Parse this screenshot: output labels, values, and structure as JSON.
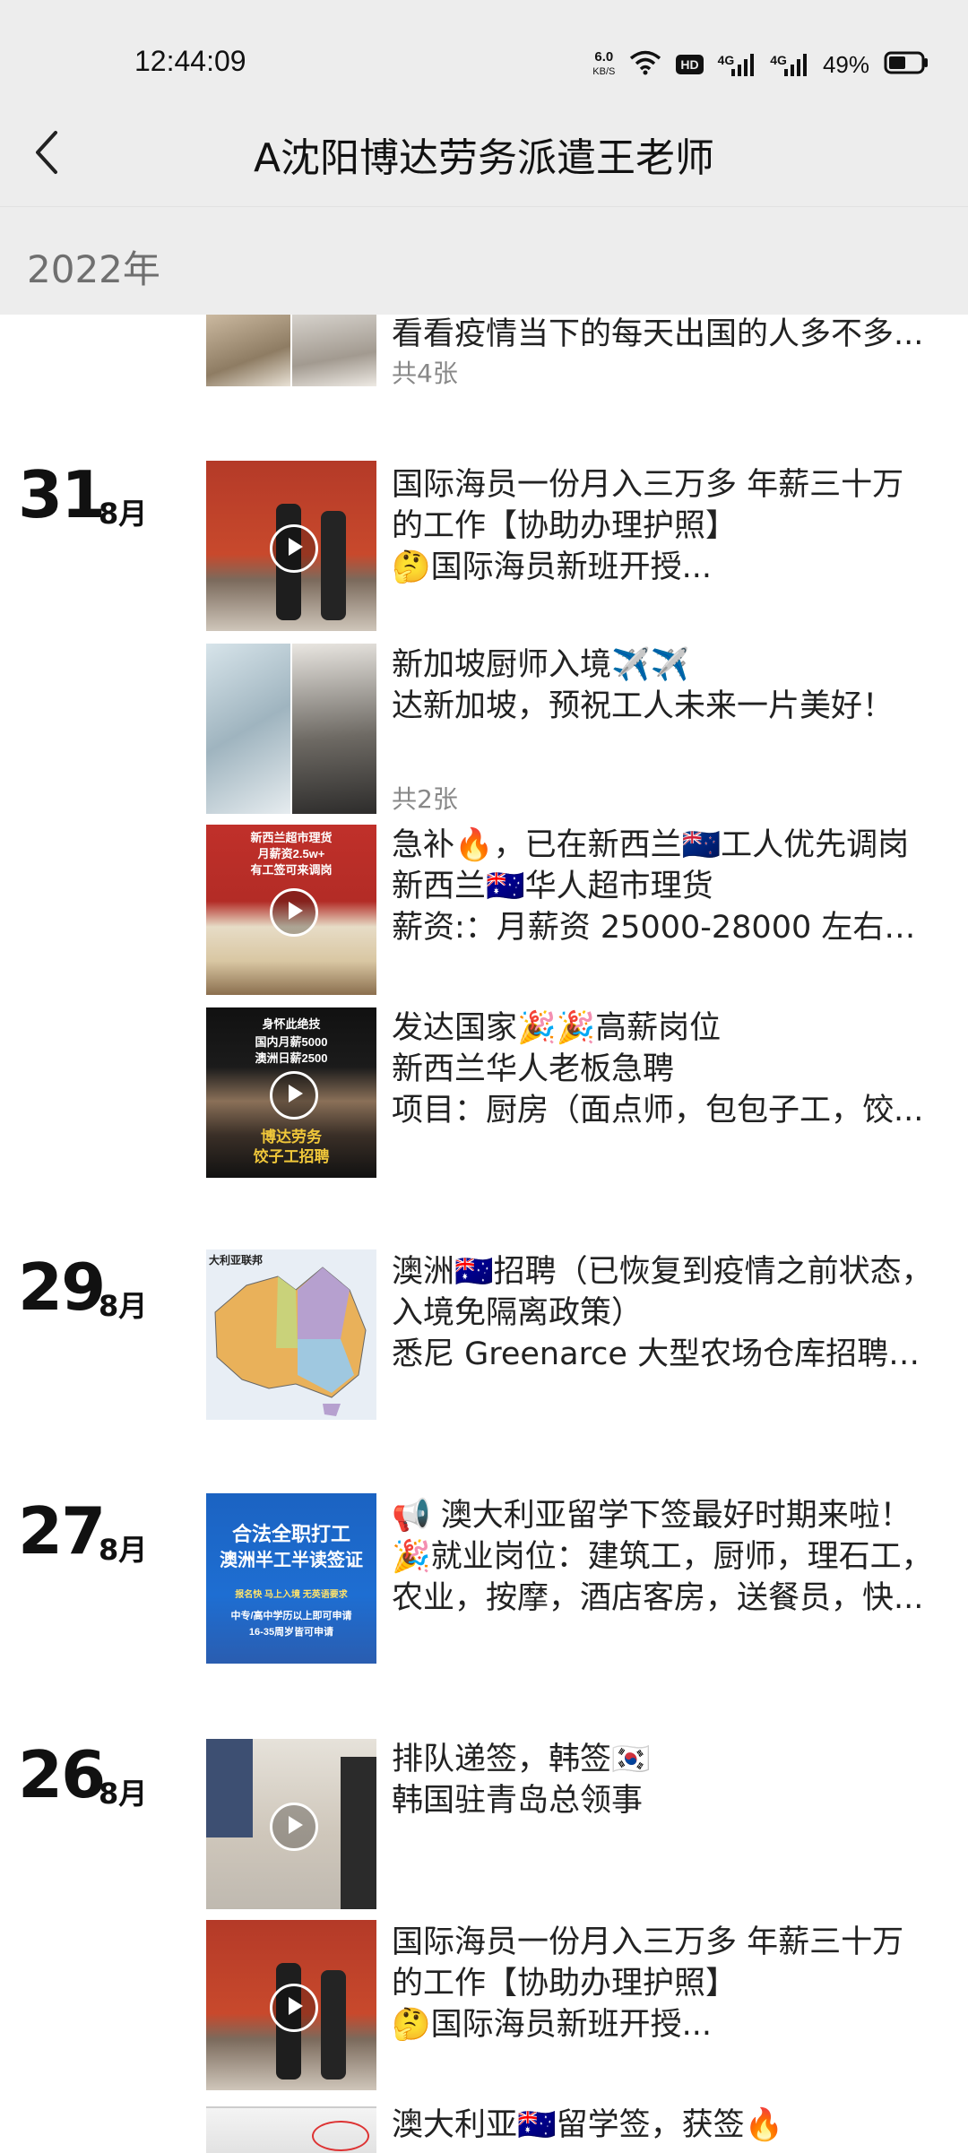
{
  "status": {
    "time": "12:44:09",
    "net_speed_value": "6.0",
    "net_speed_unit": "KB/S",
    "hd_label": "HD",
    "signal1_label": "4G",
    "signal2_label": "4G",
    "battery_percent": "49%"
  },
  "nav": {
    "title": "A沈阳博达劳务派遣王老师"
  },
  "year_label": "2022年",
  "top_post": {
    "text": "看看疫情当下的每天出国的人多不多...",
    "count": "共4张"
  },
  "groups": [
    {
      "day": "31",
      "month": "8月"
    },
    {
      "day": "29",
      "month": "8月"
    },
    {
      "day": "27",
      "month": "8月"
    },
    {
      "day": "26",
      "month": "8月"
    }
  ],
  "posts": {
    "p31a": {
      "lines": [
        "国际海员一份月入三万多 年薪三十万",
        "的工作【协助办理护照】",
        "🤔国际海员新班开授..."
      ]
    },
    "p31b": {
      "lines": [
        "新加坡厨师入境✈️✈️",
        "达新加坡，预祝工人未来一片美好！"
      ],
      "count": "共2张"
    },
    "p31c": {
      "lines": [
        "急补🔥，已在新西兰🇳🇿工人优先调岗",
        "新西兰🇦🇺华人超市理货",
        "薪资:：月薪资 25000-28000 左右（..."
      ],
      "thumb_text_1": "新西兰超市理货",
      "thumb_text_2": "月薪资2.5w+",
      "thumb_text_3": "有工签可来调岗"
    },
    "p31d": {
      "lines": [
        "发达国家🎉🎉高薪岗位",
        "新西兰华人老板急聘",
        "项目：厨房（面点师，包包子工，饺..."
      ],
      "thumb_text_1": "身怀此绝技",
      "thumb_text_2": "国内月薪5000",
      "thumb_text_3": "澳洲日薪2500",
      "thumb_text_4": "博达劳务",
      "thumb_text_5": "饺子工招聘"
    },
    "p29a": {
      "lines": [
        "澳洲🇦🇺招聘（已恢复到疫情之前状态，",
        "入境免隔离政策）",
        "悉尼 Greenarce 大型农场仓库招聘仓..."
      ],
      "thumb_title": "大利亚联邦"
    },
    "p27a": {
      "lines": [
        "📢 澳大利亚留学下签最好时期来啦！",
        "🎉就业岗位：建筑工，厨师，理石工，",
        "农业，按摩，酒店客房，送餐员，快..."
      ],
      "thumb_text_1": "合法全职打工",
      "thumb_text_2": "澳洲半工半读签证",
      "thumb_text_3": "报名快 马上入境 无英语要求",
      "thumb_text_4": "中专/高中学历以上即可申请",
      "thumb_text_5": "16-35周岁皆可申请"
    },
    "p26a": {
      "lines": [
        "排队递签，韩签🇰🇷",
        "韩国驻青岛总领事"
      ]
    },
    "p26b": {
      "lines": [
        "国际海员一份月入三万多 年薪三十万",
        "的工作【协助办理护照】",
        "🤔国际海员新班开授..."
      ]
    },
    "p26c": {
      "lines": [
        "澳大利亚🇦🇺留学签，获签🔥"
      ]
    }
  },
  "colors": {
    "header_bg": "#ededed",
    "page_bg": "#ffffff",
    "meta_gray": "#888888"
  }
}
